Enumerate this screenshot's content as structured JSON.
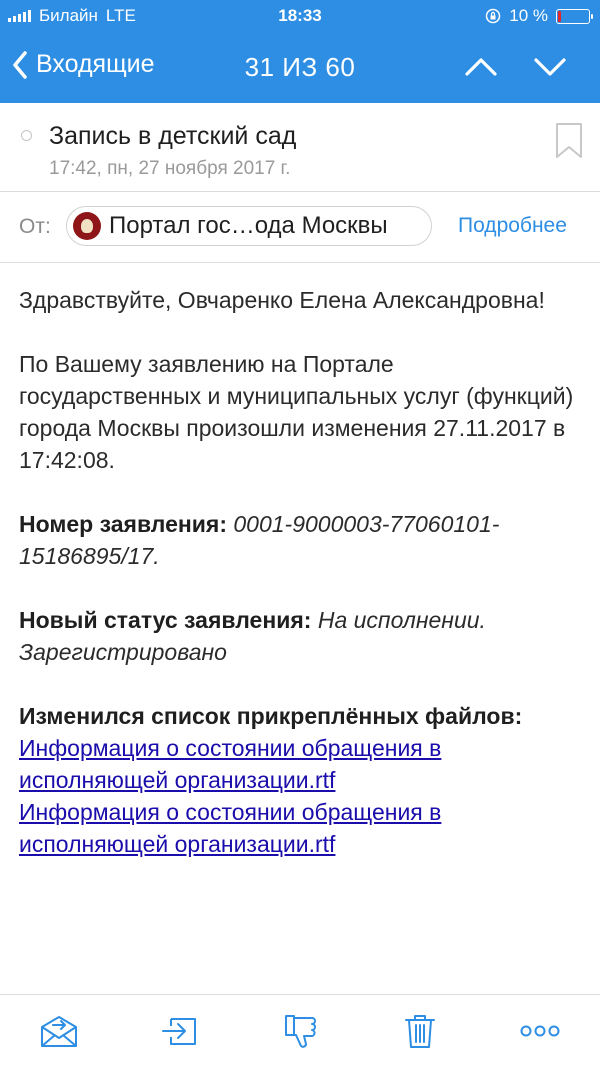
{
  "status_bar": {
    "carrier": "Билайн",
    "network": "LTE",
    "time": "18:33",
    "battery_percent": "10 %",
    "battery_level": 0.1,
    "battery_color": "#e1262d"
  },
  "nav": {
    "back_label": "Входящие",
    "counter": "31 ИЗ 60",
    "prev_icon": "chevron-up-icon",
    "next_icon": "chevron-down-icon"
  },
  "message": {
    "subject": "Запись в детский сад",
    "date": "17:42, пн, 27 ноября 2017 г.",
    "from_label": "От:",
    "sender": "Портал гос…ода Москвы",
    "details_link": "Подробнее"
  },
  "body": {
    "greeting": "Здравствуйте, Овчаренко Елена Александровна!",
    "intro": "По Вашему заявлению на Портале государственных и муниципальных услуг (функций) города Москвы произошли изменения 27.11.2017 в 17:42:08.",
    "number_label": "Номер заявления:",
    "number_value": "0001-9000003-77060101-15186895/17.",
    "status_label": "Новый статус заявления:",
    "status_value": "На исполнении. Зарегистрировано",
    "files_label": "Изменился список прикреплённых файлов:",
    "attachments": [
      "Информация о состоянии обращения в исполняющей организации.rtf",
      "Информация о состоянии обращения в исполняющей организации.rtf"
    ]
  },
  "toolbar": {
    "icons": [
      "mail-move-icon",
      "forward-icon",
      "thumbs-down-icon",
      "trash-icon",
      "more-icon"
    ]
  },
  "colors": {
    "accent": "#2d8ee3",
    "link": "#1a0dab"
  }
}
